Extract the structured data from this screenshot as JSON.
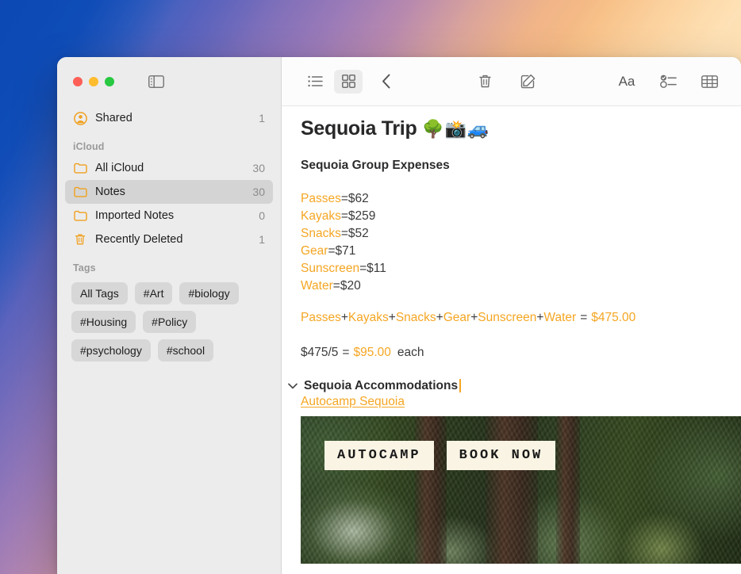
{
  "window": {
    "traffic_lights": [
      "close",
      "minimize",
      "zoom"
    ],
    "sidebar_toggle_label": "Toggle Sidebar"
  },
  "sidebar": {
    "shared": {
      "label": "Shared",
      "count": "1",
      "icon": "shared-person-icon"
    },
    "sections": [
      {
        "header": "iCloud",
        "items": [
          {
            "label": "All iCloud",
            "count": "30",
            "icon": "folder-icon",
            "selected": false
          },
          {
            "label": "Notes",
            "count": "30",
            "icon": "folder-icon",
            "selected": true
          },
          {
            "label": "Imported Notes",
            "count": "0",
            "icon": "folder-icon",
            "selected": false
          },
          {
            "label": "Recently Deleted",
            "count": "1",
            "icon": "trash-icon",
            "selected": false
          }
        ]
      }
    ],
    "tags_header": "Tags",
    "tags": [
      "All Tags",
      "#Art",
      "#biology",
      "#Housing",
      "#Policy",
      "#psychology",
      "#school"
    ]
  },
  "toolbar": {
    "left": [
      {
        "name": "list-view-icon",
        "label": "List View",
        "active": false
      },
      {
        "name": "gallery-view-icon",
        "label": "Gallery View",
        "active": true
      },
      {
        "name": "back-chevron-icon",
        "label": "Back",
        "active": false
      }
    ],
    "middle": [
      {
        "name": "trash-icon",
        "label": "Delete Note"
      },
      {
        "name": "compose-icon",
        "label": "New Note"
      }
    ],
    "right": [
      {
        "name": "format-aa-icon",
        "label": "Aa"
      },
      {
        "name": "checklist-icon",
        "label": "Checklist"
      },
      {
        "name": "table-icon",
        "label": "Table"
      }
    ]
  },
  "note": {
    "title_text": "Sequoia Trip",
    "title_emoji": "🌳📸🚙",
    "subtitle": "Sequoia Group Expenses",
    "expenses": [
      {
        "name": "Passes",
        "eq": "=",
        "value": "$62"
      },
      {
        "name": "Kayaks",
        "eq": "=",
        "value": "$259"
      },
      {
        "name": "Snacks",
        "eq": "=",
        "value": "$52"
      },
      {
        "name": "Gear",
        "eq": "=",
        "value": "$71"
      },
      {
        "name": "Sunscreen",
        "eq": "=",
        "value": "$11"
      },
      {
        "name": "Water",
        "eq": "=",
        "value": "$20"
      }
    ],
    "sum_line": {
      "terms": [
        "Passes",
        "Kayaks",
        "Snacks",
        "Gear",
        "Sunscreen",
        "Water"
      ],
      "plus": "+",
      "equals": "=",
      "total": "$475.00"
    },
    "each_line": {
      "expression": "$475/5",
      "equals": "=",
      "result": "$95.00",
      "suffix": "each"
    },
    "collapsible_heading": {
      "chevron": "chevron-down-icon",
      "text": "Sequoia Accommodations",
      "cursor_color": "#f5a623"
    },
    "link": {
      "text": "Autocamp Sequoia"
    },
    "preview": {
      "badge_primary": "AUTOCAMP",
      "badge_secondary": "BOOK NOW",
      "alt": "Forest with redwood trunks and green foliage"
    }
  },
  "colors": {
    "accent_orange": "#f5a623",
    "sidebar_bg": "#ececec",
    "selected_row": "#d4d4d4",
    "tag_pill": "#d7d7d7",
    "text_primary": "#1d1d1f",
    "text_secondary": "#8c8c8c"
  }
}
